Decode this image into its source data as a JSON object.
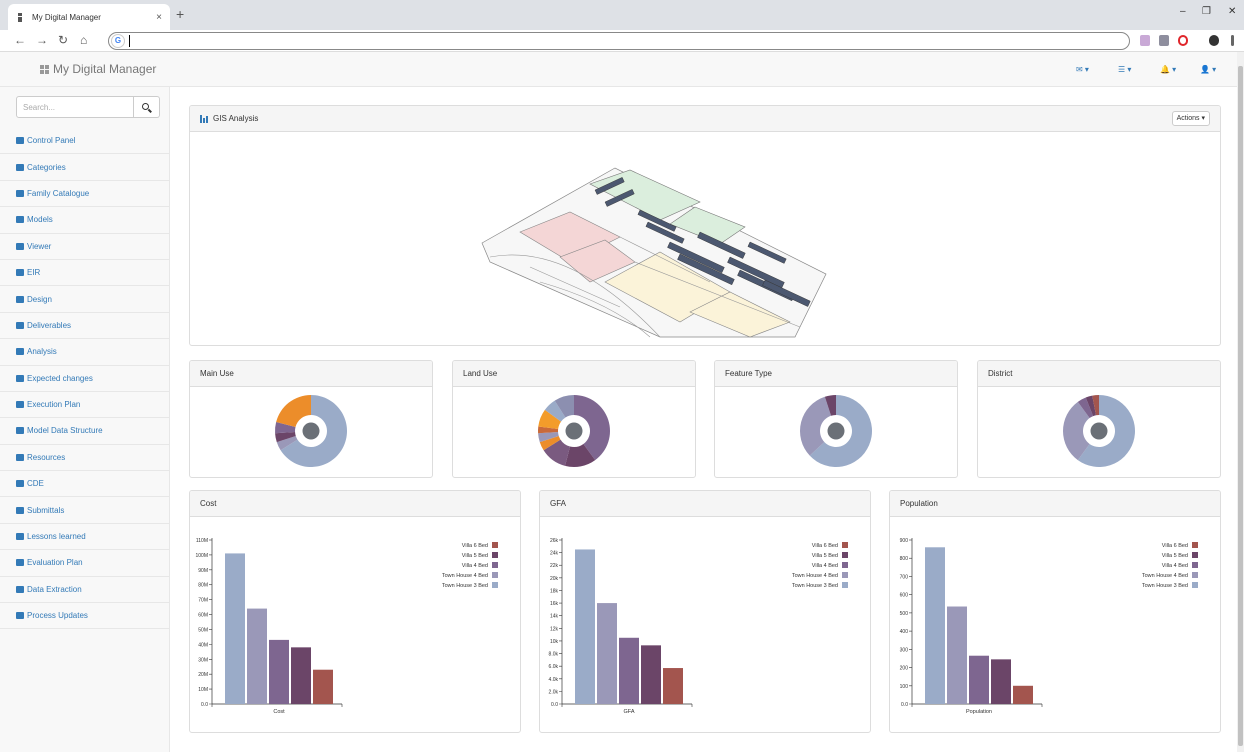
{
  "browser": {
    "tab_title": "My Digital Manager",
    "tab_close": "×",
    "new_tab": "+",
    "minimize": "–",
    "restore": "❐",
    "close": "✕",
    "back": "←",
    "forward": "→",
    "reload": "↻",
    "home": "⌂",
    "omnibox_icon": "G"
  },
  "header": {
    "title": "My Digital Manager",
    "dropdowns": [
      "✉ ▾",
      "☰ ▾",
      "🔔 ▾",
      "👤 ▾"
    ]
  },
  "sidebar": {
    "search_placeholder": "Search...",
    "items": [
      {
        "label": "Control Panel",
        "icon": "dashboard-icon"
      },
      {
        "label": "Categories",
        "icon": "tag-icon"
      },
      {
        "label": "Family Catalogue",
        "icon": "list-icon"
      },
      {
        "label": "Models",
        "icon": "cubes-icon"
      },
      {
        "label": "Viewer",
        "icon": "monitor-icon"
      },
      {
        "label": "EIR",
        "icon": "info-icon"
      },
      {
        "label": "Design",
        "icon": "pencil-icon"
      },
      {
        "label": "Deliverables",
        "icon": "briefcase-icon"
      },
      {
        "label": "Analysis",
        "icon": "bar-chart-icon"
      },
      {
        "label": "Expected changes",
        "icon": "shuffle-icon"
      },
      {
        "label": "Execution Plan",
        "icon": "map-marker-icon"
      },
      {
        "label": "Model Data Structure",
        "icon": "cogs-icon"
      },
      {
        "label": "Resources",
        "icon": "share-icon"
      },
      {
        "label": "CDE",
        "icon": "cloud-icon"
      },
      {
        "label": "Submittals",
        "icon": "paragraph-icon"
      },
      {
        "label": "Lessons learned",
        "icon": "book-icon"
      },
      {
        "label": "Evaluation Plan",
        "icon": "line-chart-icon"
      },
      {
        "label": "Data Extraction",
        "icon": "save-icon"
      },
      {
        "label": "Process Updates",
        "icon": "refresh-icon"
      }
    ]
  },
  "gis": {
    "title": "GIS Analysis",
    "actions_label": "Actions ▾"
  },
  "colors": {
    "villa6": "#a3554e",
    "villa5": "#6b4568",
    "villa4": "#7e6690",
    "th4": "#9a98b8",
    "th3": "#9aabc8",
    "orange": "#ec8d2a",
    "center": "#6b7077"
  },
  "pie_panels": [
    {
      "title": "Main Use",
      "slices": [
        {
          "v": 66,
          "c": "#9aabc8"
        },
        {
          "v": 4,
          "c": "#9a98b8"
        },
        {
          "v": 4,
          "c": "#6b4568"
        },
        {
          "v": 5,
          "c": "#7e6690"
        },
        {
          "v": 21,
          "c": "#ec8d2a"
        }
      ]
    },
    {
      "title": "Land Use",
      "slices": [
        {
          "v": 40,
          "c": "#7e6690"
        },
        {
          "v": 14,
          "c": "#6b4568"
        },
        {
          "v": 12,
          "c": "#7a5a80"
        },
        {
          "v": 4,
          "c": "#ec8d2a"
        },
        {
          "v": 4,
          "c": "#9a98b8"
        },
        {
          "v": 3,
          "c": "#c96a3a"
        },
        {
          "v": 8,
          "c": "#f39c2a"
        },
        {
          "v": 6,
          "c": "#9aabc8"
        },
        {
          "v": 9,
          "c": "#8c8fb0"
        }
      ]
    },
    {
      "title": "Feature Type",
      "slices": [
        {
          "v": 63,
          "c": "#9aabc8"
        },
        {
          "v": 32,
          "c": "#9a98b8"
        },
        {
          "v": 5,
          "c": "#6b4568"
        }
      ]
    },
    {
      "title": "District",
      "slices": [
        {
          "v": 60,
          "c": "#9aabc8"
        },
        {
          "v": 30,
          "c": "#9a98b8"
        },
        {
          "v": 4,
          "c": "#7e6690"
        },
        {
          "v": 3,
          "c": "#6b4568"
        },
        {
          "v": 3,
          "c": "#a3554e"
        }
      ]
    }
  ],
  "chart_data": [
    {
      "type": "bar",
      "title": "Cost",
      "xlabel": "Cost",
      "ylim": [
        0,
        110000000
      ],
      "ticks": [
        0,
        10000000,
        20000000,
        30000000,
        40000000,
        50000000,
        60000000,
        70000000,
        80000000,
        90000000,
        100000000,
        110000000
      ],
      "tick_labels": [
        "0.0",
        "10M",
        "20M",
        "30M",
        "40M",
        "50M",
        "60M",
        "70M",
        "80M",
        "90M",
        "100M",
        "110M"
      ],
      "series": [
        {
          "name": "Town House 3 Bed",
          "value": 101000000,
          "color": "#9aabc8"
        },
        {
          "name": "Town House 4 Bed",
          "value": 64000000,
          "color": "#9a98b8"
        },
        {
          "name": "Villa 4 Bed",
          "value": 43000000,
          "color": "#7e6690"
        },
        {
          "name": "Villa 5 Bed",
          "value": 38000000,
          "color": "#6b4568"
        },
        {
          "name": "Villa 6 Bed",
          "value": 23000000,
          "color": "#a3554e"
        }
      ],
      "legend": [
        "Villa 6 Bed",
        "Villa 5 Bed",
        "Villa 4 Bed",
        "Town House 4 Bed",
        "Town House 3 Bed"
      ],
      "legend_placement": "top-right"
    },
    {
      "type": "bar",
      "title": "GFA",
      "xlabel": "GFA",
      "ylim": [
        0,
        26000
      ],
      "ticks": [
        0,
        2000,
        4000,
        6000,
        8000,
        10000,
        12000,
        14000,
        16000,
        18000,
        20000,
        22000,
        24000,
        26000
      ],
      "tick_labels": [
        "0.0",
        "2.0k",
        "4.0k",
        "6.0k",
        "8.0k",
        "10k",
        "12k",
        "14k",
        "16k",
        "18k",
        "20k",
        "22k",
        "24k",
        "26k"
      ],
      "series": [
        {
          "name": "Town House 3 Bed",
          "value": 24500,
          "color": "#9aabc8"
        },
        {
          "name": "Town House 4 Bed",
          "value": 16000,
          "color": "#9a98b8"
        },
        {
          "name": "Villa 4 Bed",
          "value": 10500,
          "color": "#7e6690"
        },
        {
          "name": "Villa 5 Bed",
          "value": 9300,
          "color": "#6b4568"
        },
        {
          "name": "Villa 6 Bed",
          "value": 5700,
          "color": "#a3554e"
        }
      ],
      "legend": [
        "Villa 6 Bed",
        "Villa 5 Bed",
        "Villa 4 Bed",
        "Town House 4 Bed",
        "Town House 3 Bed"
      ],
      "legend_placement": "top-right"
    },
    {
      "type": "bar",
      "title": "Population",
      "xlabel": "Population",
      "ylim": [
        0,
        900
      ],
      "ticks": [
        0,
        100,
        200,
        300,
        400,
        500,
        600,
        700,
        800,
        900
      ],
      "tick_labels": [
        "0.0",
        "100",
        "200",
        "300",
        "400",
        "500",
        "600",
        "700",
        "800",
        "900"
      ],
      "series": [
        {
          "name": "Town House 3 Bed",
          "value": 860,
          "color": "#9aabc8"
        },
        {
          "name": "Town House 4 Bed",
          "value": 535,
          "color": "#9a98b8"
        },
        {
          "name": "Villa 4 Bed",
          "value": 265,
          "color": "#7e6690"
        },
        {
          "name": "Villa 5 Bed",
          "value": 245,
          "color": "#6b4568"
        },
        {
          "name": "Villa 6 Bed",
          "value": 100,
          "color": "#a3554e"
        }
      ],
      "legend": [
        "Villa 6 Bed",
        "Villa 5 Bed",
        "Villa 4 Bed",
        "Town House 4 Bed",
        "Town House 3 Bed"
      ],
      "legend_placement": "top-right"
    }
  ]
}
